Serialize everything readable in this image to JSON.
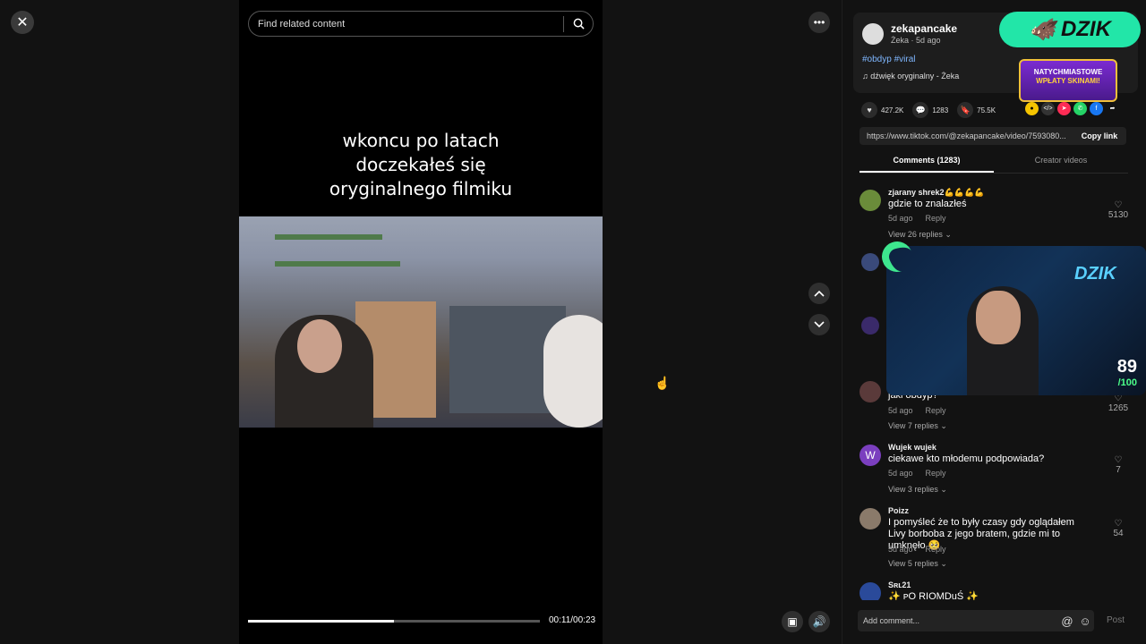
{
  "player": {
    "search_placeholder": "Find related content",
    "overlay_lines": [
      "wkoncu po latach",
      "doczekałeś się",
      "oryginalnego filmiku"
    ],
    "time": "00:11/00:23",
    "progress_fraction": 0.5
  },
  "author": {
    "name": "zekapancake",
    "meta": "Żeka · 5d ago",
    "hashtags": "#obdyp #viral",
    "sound": "dźwięk oryginalny - Żeka"
  },
  "ads": {
    "brand": "DZIK",
    "promo_line1": "NATYCHMIASTOWE",
    "promo_line2": "WPŁATY SKINAMI!"
  },
  "stats": {
    "likes": "427.2K",
    "comments": "1283",
    "saves": "75.5K"
  },
  "share": {
    "url": "https://www.tiktok.com/@zekapancake/video/7593080...",
    "copy_label": "Copy link"
  },
  "tabs": {
    "comments": "Comments (1283)",
    "creator": "Creator videos"
  },
  "comments": [
    {
      "user": "zjarany shrek2💪💪💪💪",
      "text": "gdzie to znalazłeś",
      "time": "5d ago",
      "reply": "Reply",
      "likes": "5130",
      "replies": "View 26 replies ⌄"
    },
    {
      "user": "",
      "text": "jaki obdyp?",
      "time": "5d ago",
      "reply": "Reply",
      "likes": "1265",
      "replies": "View 7 replies ⌄"
    },
    {
      "user": "Wujek wujek",
      "text": "ciekawe kto młodemu podpowiada?",
      "time": "5d ago",
      "reply": "Reply",
      "likes": "7",
      "replies": "View 3 replies ⌄"
    },
    {
      "user": "Poizz",
      "text": "I pomyśleć że to były czasy gdy oglądałem Livy borboba z jego bratem, gdzie mi to umknęło 🥺",
      "time": "5d ago",
      "reply": "Reply",
      "likes": "54",
      "replies": "View 5 replies ⌄"
    },
    {
      "user": "Sʀʟ21",
      "text": "✨ ᴘO RIOMDuŚ ✨",
      "time": "",
      "reply": "",
      "likes": "",
      "replies": ""
    }
  ],
  "webcam": {
    "sign": "DZIK",
    "score": "89",
    "score_max": "/100"
  },
  "composer": {
    "placeholder": "Add comment...",
    "post_label": "Post"
  },
  "colors": {
    "brand_green": "#22e6a8",
    "hashtag": "#7fb7ff"
  }
}
